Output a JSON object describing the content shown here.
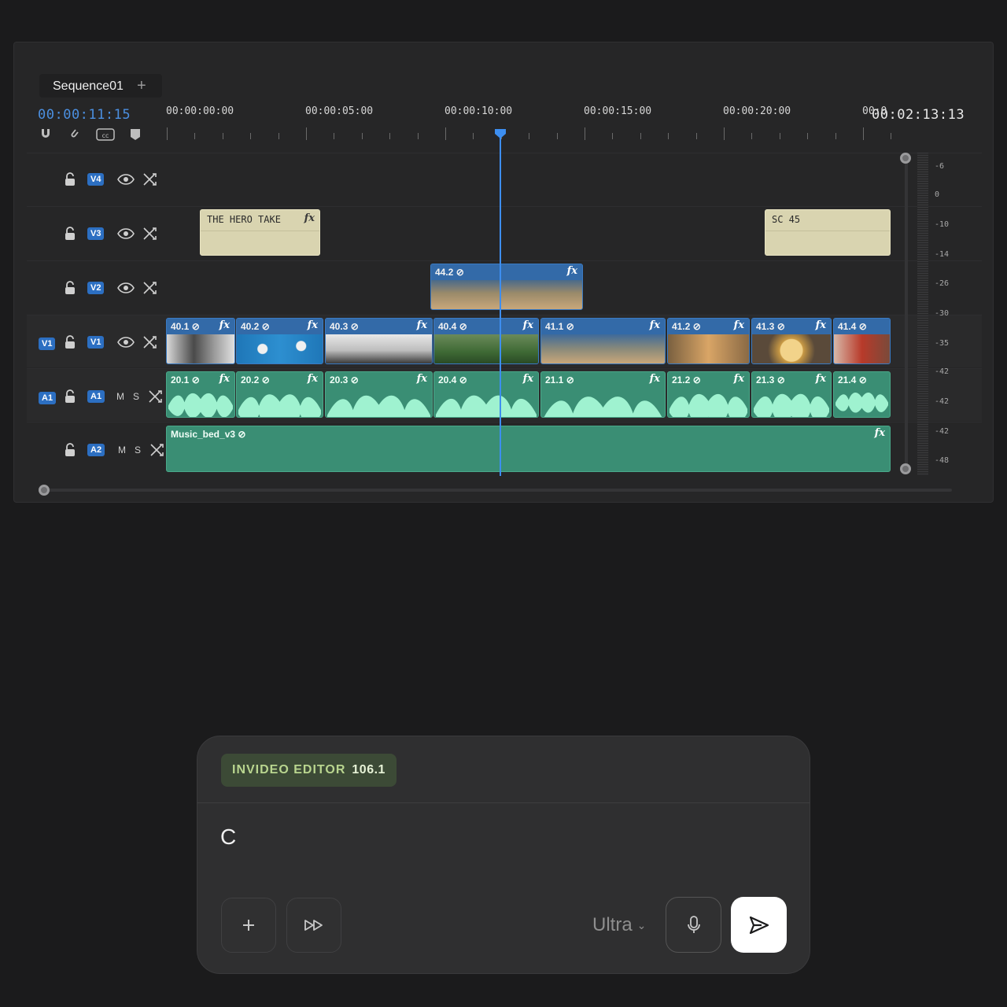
{
  "sequence_tab": {
    "label": "Sequence01",
    "add": "+"
  },
  "timecode": {
    "current": "00:00:11:15",
    "end": "00:02:13:13"
  },
  "ruler": {
    "labels": [
      "00:00:00:00",
      "00:00:05:00",
      "00:00:10:00",
      "00:00:15:00",
      "00:00:20:00",
      "00:0"
    ]
  },
  "tracks": {
    "v4": "V4",
    "v3": "V3",
    "v2": "V2",
    "v1": "V1",
    "v1_source": "V1",
    "a1": "A1",
    "a1_source": "A1",
    "a2": "A2",
    "mute": "M",
    "solo": "S"
  },
  "clips": {
    "v3_title1": "THE HERO TAKE",
    "v3_title2": "SC 45",
    "v2": "44.2",
    "v1": [
      "40.1",
      "40.2",
      "40.3",
      "40.4",
      "41.1",
      "41.2",
      "41.3",
      "41.4"
    ],
    "a1": [
      "20.1",
      "20.2",
      "20.3",
      "20.4",
      "21.1",
      "21.2",
      "21.3",
      "21.4"
    ],
    "a2": "Music_bed_v3",
    "fx": "fx"
  },
  "meter": {
    "labels": [
      "-6",
      "0",
      "-10",
      "-14",
      "-26",
      "-30",
      "-35",
      "-42",
      "-42",
      "-42",
      "-48"
    ]
  },
  "prompt": {
    "badge_name": "INVIDEO EDITOR",
    "badge_version": "106.1",
    "text": "C",
    "model": "Ultra",
    "model_caret": "⌄"
  },
  "colors": {
    "accent": "#3d8ef0",
    "video_clip": "#2b5f9c",
    "audio_clip": "#3a8e74",
    "title_clip": "#d9d4b0",
    "badge": "#3c4a36"
  }
}
